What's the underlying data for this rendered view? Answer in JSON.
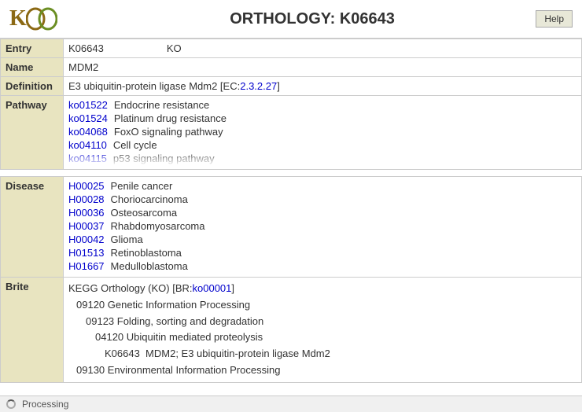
{
  "header": {
    "logo_kf": "KF",
    "logo_gg": "GG",
    "title": "ORTHOLOGY: K06643",
    "help_label": "Help"
  },
  "entry": {
    "label": "Entry",
    "id": "K06643",
    "type": "KO"
  },
  "name": {
    "label": "Name",
    "value": "MDM2"
  },
  "definition": {
    "label": "Definition",
    "value": "E3 ubiquitin-protein ligase Mdm2 [EC:2.3.2.27]"
  },
  "pathway": {
    "label": "Pathway",
    "items": [
      {
        "code": "ko01522",
        "description": "Endocrine resistance"
      },
      {
        "code": "ko01524",
        "description": "Platinum drug resistance"
      },
      {
        "code": "ko04068",
        "description": "FoxO signaling pathway"
      },
      {
        "code": "ko04110",
        "description": "Cell cycle"
      },
      {
        "code": "ko04115",
        "description": "p53 signaling pathway"
      }
    ]
  },
  "disease": {
    "label": "Disease",
    "items": [
      {
        "code": "H00025",
        "description": "Penile cancer"
      },
      {
        "code": "H00028",
        "description": "Choriocarcinoma"
      },
      {
        "code": "H00036",
        "description": "Osteosarcoma"
      },
      {
        "code": "H00037",
        "description": "Rhabdomyosarcoma"
      },
      {
        "code": "H00042",
        "description": "Glioma"
      },
      {
        "code": "H01513",
        "description": "Retinoblastoma"
      },
      {
        "code": "H01667",
        "description": "Medulloblastoma"
      }
    ]
  },
  "brite": {
    "label": "Brite",
    "lines": [
      {
        "text": "KEGG Orthology (KO) [BR:",
        "link_text": "ko00001",
        "link": "ko00001",
        "suffix": "]",
        "indent": 0
      },
      {
        "text": "09120 Genetic Information Processing",
        "indent": 1
      },
      {
        "text": "09123 Folding, sorting and degradation",
        "indent": 2
      },
      {
        "text": "04120 Ubiquitin mediated proteolysis",
        "indent": 3
      },
      {
        "text": "K06643  MDM2; E3 ubiquitin-protein ligase Mdm2",
        "indent": 4
      },
      {
        "text": "09130 Environmental Information Processing",
        "indent": 1
      }
    ]
  },
  "status": {
    "text": "Processing",
    "spinner": true
  }
}
